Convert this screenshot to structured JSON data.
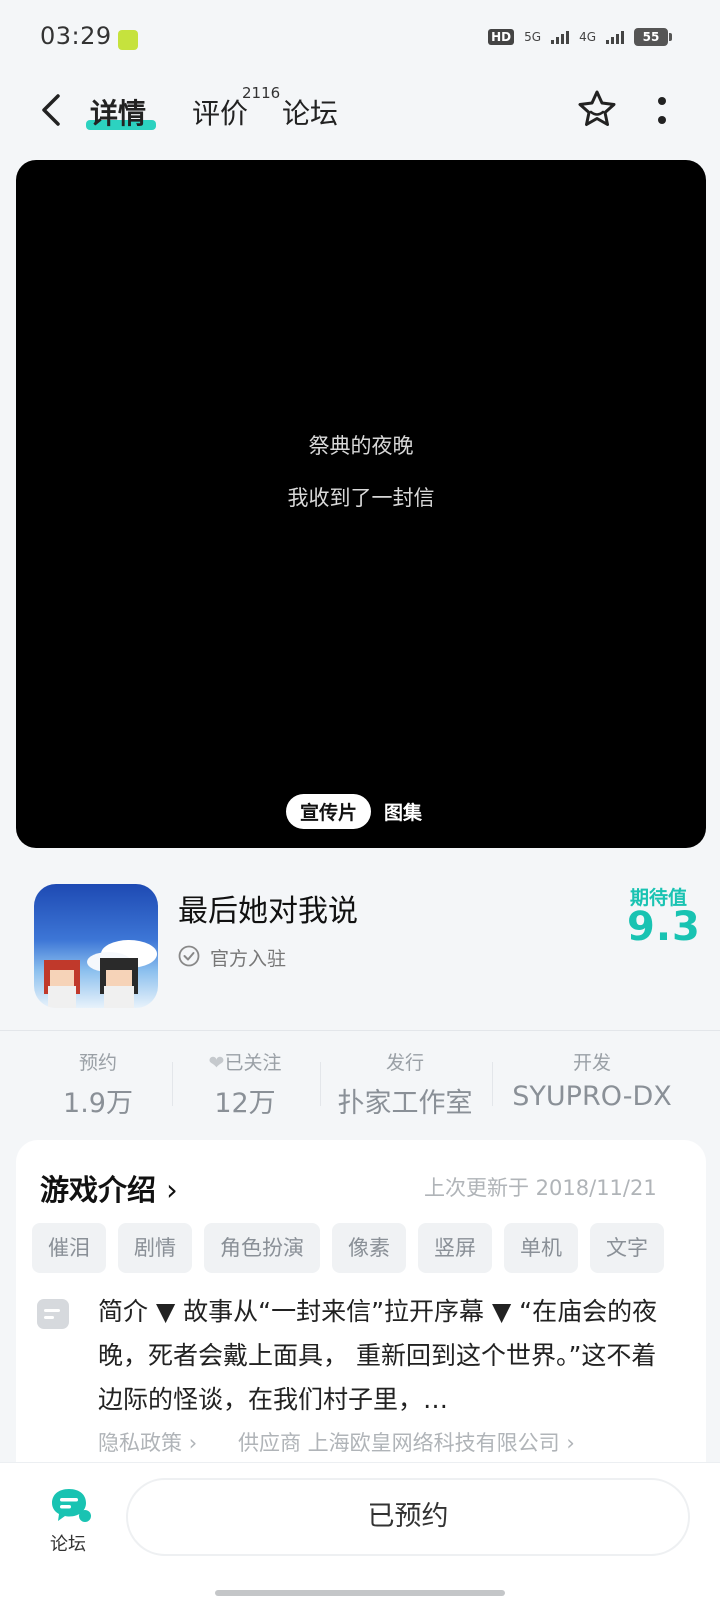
{
  "status_bar": {
    "time": "03:29",
    "hd_label": "HD",
    "network_5g": "5G",
    "network_4g": "4G",
    "battery": "55"
  },
  "nav": {
    "tabs": [
      {
        "label": "详情"
      },
      {
        "label": "评价"
      },
      {
        "label": "论坛"
      }
    ],
    "review_count": "2116"
  },
  "media": {
    "lines": [
      "祭典的夜晚",
      "我收到了一封信"
    ],
    "trailer_label": "宣传片",
    "gallery_label": "图集"
  },
  "game": {
    "title": "最后她对我说",
    "official_label": "官方入驻",
    "anticipation_label": "期待值",
    "anticipation_value": "9.3"
  },
  "stats": [
    {
      "label": "预约",
      "value": "1.9万"
    },
    {
      "label": "已关注",
      "value": "12万"
    },
    {
      "label": "发行",
      "value": "扑家工作室"
    },
    {
      "label": "开发",
      "value": "SYUPRO-DX"
    }
  ],
  "intro": {
    "title": "游戏介绍",
    "updated": "上次更新于 2018/11/21",
    "tags": [
      "催泪",
      "剧情",
      "角色扮演",
      "像素",
      "竖屏",
      "单机",
      "文字"
    ],
    "description": "简介 ▼ 故事从“一封来信”拉开序幕 ▼ “在庙会的夜晚，死者会戴上面具， 重新回到这个世界。”这不着边际的怪谈，在我们村子里，…",
    "privacy_label": "隐私政策",
    "supplier_label": "供应商 上海欧皇网络科技有限公司"
  },
  "bottom": {
    "forum_label": "论坛",
    "reserve_label": "已预约"
  },
  "colors": {
    "accent": "#19c3b2",
    "background": "#f4f6f8"
  }
}
